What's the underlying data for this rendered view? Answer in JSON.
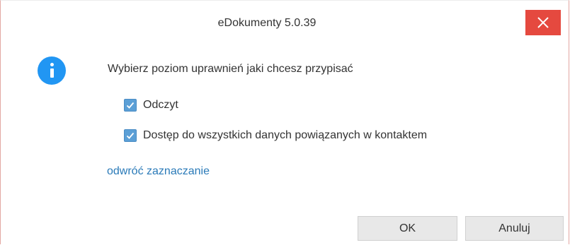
{
  "window": {
    "title": "eDokumenty 5.0.39",
    "close_color": "#e5493f"
  },
  "message": {
    "icon": "info-icon",
    "text": "Wybierz poziom uprawnień jaki chcesz przypisać"
  },
  "options": [
    {
      "label": "Odczyt",
      "checked": true
    },
    {
      "label": "Dostęp do wszystkich danych powiązanych w kontaktem",
      "checked": true
    }
  ],
  "invert_link": "odwróć zaznaczanie",
  "buttons": {
    "ok": "OK",
    "cancel": "Anuluj"
  },
  "colors": {
    "accent": "#2196f3",
    "link": "#2a7ab8",
    "checkbox": "#5b9fd6"
  }
}
